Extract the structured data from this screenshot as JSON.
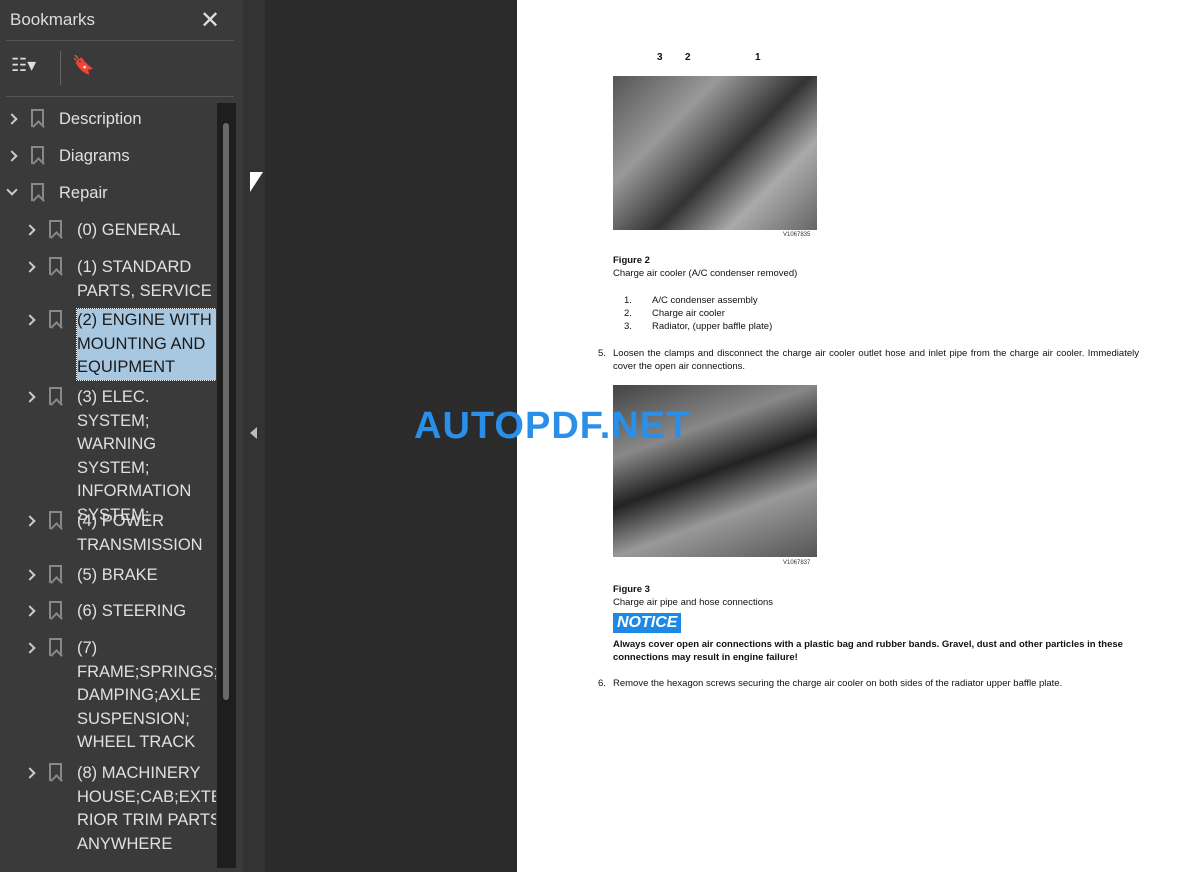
{
  "sidebar": {
    "title": "Bookmarks",
    "close_icon": "close-icon",
    "items": [
      {
        "label": "Description",
        "expanded": false
      },
      {
        "label": "Diagrams",
        "expanded": false
      },
      {
        "label": "Repair",
        "expanded": true
      },
      {
        "label": "(0) GENERAL"
      },
      {
        "label": "(1) STANDARD\nPARTS, SERVICE"
      },
      {
        "label": "(2) ENGINE WITH\nMOUNTING AND\nEQUIPMENT",
        "selected": true
      },
      {
        "label": "(3) ELEC. SYSTEM;\nWARNING\nSYSTEM;\nINFORMATION\nSYSTEM;"
      },
      {
        "label": "(4) POWER\nTRANSMISSION"
      },
      {
        "label": "(5) BRAKE"
      },
      {
        "label": "(6) STEERING"
      },
      {
        "label": "(7)\nFRAME;SPRINGS;\nDAMPING;AXLE\nSUSPENSION;\nWHEEL TRACK"
      },
      {
        "label": "(8) MACHINERY\nHOUSE;CAB;EXTE\nRIOR TRIM PARTS\nANYWHERE"
      }
    ]
  },
  "document": {
    "fig2": {
      "callouts": [
        "3",
        "2",
        "1"
      ],
      "code": "V1067835",
      "title": "Figure 2",
      "caption": "Charge air cooler (A/C condenser removed)",
      "list": [
        {
          "n": "1.",
          "t": "A/C condenser assembly"
        },
        {
          "n": "2.",
          "t": "Charge air cooler"
        },
        {
          "n": "3.",
          "t": "Radiator, (upper baffle plate)"
        }
      ]
    },
    "step5": {
      "n": "5.",
      "t": "Loosen the clamps and disconnect the charge air cooler outlet hose and inlet pipe from the charge air cooler. Immediately cover the open air connections."
    },
    "fig3": {
      "code": "V1067837",
      "title": "Figure 3",
      "caption": "Charge air pipe and hose connections"
    },
    "notice": {
      "label": "NOTICE",
      "text": "Always cover open air connections with a plastic bag and rubber bands. Gravel, dust and other particles in these connections may result in engine failure!",
      "color": "#1e88e5"
    },
    "step6": {
      "n": "6.",
      "t": "Remove the hexagon screws securing the charge air cooler on both sides of the radiator upper baffle plate."
    }
  },
  "watermark": "AUTOPDF.NET"
}
